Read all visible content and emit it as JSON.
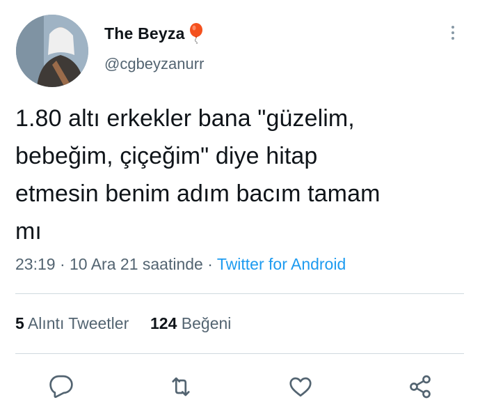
{
  "author": {
    "display_name": "The Beyza",
    "badge_emoji": "balloon",
    "handle": "@cgbeyzanurr"
  },
  "tweet": {
    "lines": [
      "1.80 altı erkekler bana \"güzelim,",
      "bebeğim, çiçeğim\" diye hitap",
      "etmesin benim adım bacım tamam",
      "mı"
    ]
  },
  "meta": {
    "time": "23:19",
    "separator": "·",
    "date": "10 Ara 21 saatinde",
    "separator2": "·",
    "source": "Twitter for Android"
  },
  "stats": {
    "quotes_count": "5",
    "quotes_label": "Alıntı Tweetler",
    "likes_count": "124",
    "likes_label": "Beğeni"
  },
  "actions": [
    "reply-icon",
    "retweet-icon",
    "like-icon",
    "share-icon"
  ],
  "colors": {
    "text": "#0f1419",
    "secondary": "#536471",
    "link": "#1d9bf0",
    "divider": "#cfd9de",
    "balloon": "#f4511e"
  }
}
